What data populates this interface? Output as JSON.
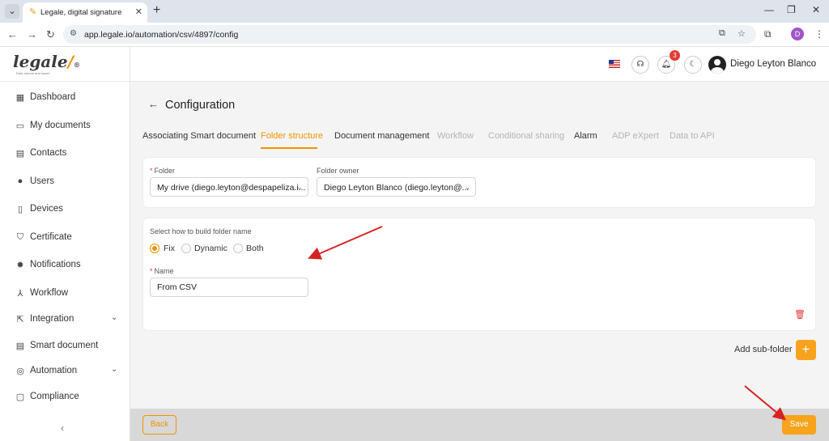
{
  "browser": {
    "tab_title": "Legale, digital signature",
    "url": "app.legale.io/automation/csv/4897/config",
    "profile_initial": "D",
    "tab_menu_icon": "chevron-down-icon",
    "new_tab_icon": "plus-icon"
  },
  "logo": {
    "word": "legale",
    "mark": "/",
    "suffix": "®",
    "tagline": "Fast, secure and smart"
  },
  "sidebar": {
    "items": [
      {
        "label": "Dashboard",
        "icon": "dashboard-icon",
        "glyph": "▦"
      },
      {
        "label": "My documents",
        "icon": "folder-icon",
        "glyph": "▭"
      },
      {
        "label": "Contacts",
        "icon": "contacts-icon",
        "glyph": "▤"
      },
      {
        "label": "Users",
        "icon": "user-icon",
        "glyph": "●"
      },
      {
        "label": "Devices",
        "icon": "device-icon",
        "glyph": "▯"
      },
      {
        "label": "Certificate",
        "icon": "shield-icon",
        "glyph": "⛉"
      },
      {
        "label": "Notifications",
        "icon": "alarm-icon",
        "glyph": "✹"
      },
      {
        "label": "Workflow",
        "icon": "workflow-icon",
        "glyph": "⅄"
      },
      {
        "label": "Integration",
        "icon": "external-link-icon",
        "glyph": "⇱"
      },
      {
        "label": "Smart document",
        "icon": "smart-document-icon",
        "glyph": "▤"
      },
      {
        "label": "Automation",
        "icon": "automation-icon",
        "glyph": "◎"
      },
      {
        "label": "Compliance",
        "icon": "chat-icon",
        "glyph": "▢"
      }
    ],
    "collapse_glyph": "‹"
  },
  "header": {
    "notification_count": "3",
    "user_name": "Diego Leyton Blanco"
  },
  "page": {
    "back_glyph": "←",
    "title": "Configuration",
    "tabs": [
      {
        "label": "Associating Smart document",
        "state": "normal"
      },
      {
        "label": "Folder structure",
        "state": "active"
      },
      {
        "label": "Document management",
        "state": "normal"
      },
      {
        "label": "Workflow",
        "state": "disabled"
      },
      {
        "label": "Conditional sharing",
        "state": "disabled"
      },
      {
        "label": "Alarm",
        "state": "normal"
      },
      {
        "label": "ADP eXpert",
        "state": "disabled"
      },
      {
        "label": "Data to API",
        "state": "disabled"
      }
    ]
  },
  "folder_card": {
    "required_mark": "*",
    "folder_label": "Folder",
    "folder_value": "My drive (diego.leyton@despapeliza.i...",
    "owner_label": "Folder owner",
    "owner_value": "Diego Leyton Blanco (diego.leyton@..."
  },
  "name_card": {
    "build_label": "Select how to build folder name",
    "options": [
      "Fix",
      "Dynamic",
      "Both"
    ],
    "selected_option": "Fix",
    "name_label": "Name",
    "name_value": "From CSV",
    "delete_icon": "trash-icon"
  },
  "actions": {
    "add_subfolder_label": "Add sub-folder",
    "add_glyph": "+",
    "back_label": "Back",
    "save_label": "Save"
  },
  "colors": {
    "accent": "#f39200",
    "annotation_arrow": "#d62222",
    "danger": "#e53935"
  }
}
